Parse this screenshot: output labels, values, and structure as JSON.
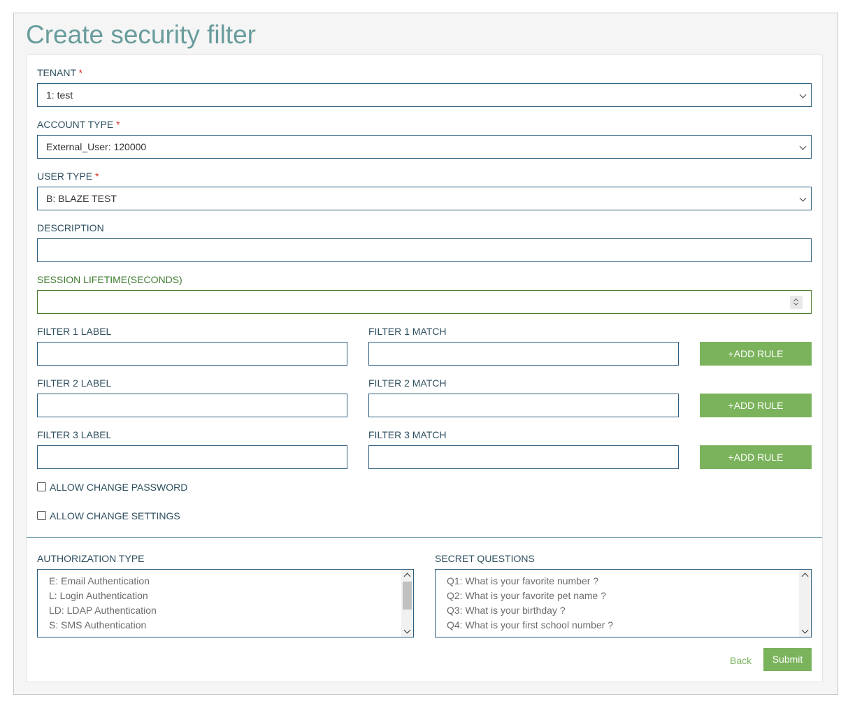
{
  "page": {
    "title": "Create security filter"
  },
  "tenant": {
    "label": "TENANT",
    "required_mark": "*",
    "value": "1: test"
  },
  "account_type": {
    "label": "ACCOUNT TYPE",
    "required_mark": "*",
    "value": "External_User: 120000"
  },
  "user_type": {
    "label": "USER TYPE",
    "required_mark": "*",
    "value": "B: BLAZE TEST"
  },
  "description": {
    "label": "DESCRIPTION",
    "value": ""
  },
  "session_lifetime": {
    "label": "SESSION LIFETIME(SECONDS)",
    "value": ""
  },
  "filters": [
    {
      "label_title": "FILTER 1 LABEL",
      "match_title": "FILTER 1 MATCH",
      "label_value": "",
      "match_value": "",
      "add_rule": "+ADD RULE"
    },
    {
      "label_title": "FILTER 2 LABEL",
      "match_title": "FILTER 2 MATCH",
      "label_value": "",
      "match_value": "",
      "add_rule": "+ADD RULE"
    },
    {
      "label_title": "FILTER 3 LABEL",
      "match_title": "FILTER 3 MATCH",
      "label_value": "",
      "match_value": "",
      "add_rule": "+ADD RULE"
    }
  ],
  "checkboxes": {
    "allow_change_password": {
      "label": "ALLOW CHANGE PASSWORD",
      "checked": false
    },
    "allow_change_settings": {
      "label": "ALLOW CHANGE SETTINGS",
      "checked": false
    }
  },
  "authorization_type": {
    "label": "AUTHORIZATION TYPE",
    "options": [
      "E: Email Authentication",
      "L: Login Authentication",
      "LD: LDAP Authentication",
      "S: SMS Authentication"
    ]
  },
  "secret_questions": {
    "label": "SECRET QUESTIONS",
    "options": [
      "Q1: What is your favorite number ?",
      "Q2: What is your favorite pet name ?",
      "Q3: What is your birthday ?",
      "Q4: What is your first school number ?"
    ]
  },
  "actions": {
    "back": "Back",
    "submit": "Submit"
  },
  "colors": {
    "accent_green": "#7bb35c",
    "title_teal": "#6a9c9c",
    "border_blue": "#2f5f80",
    "required_red": "#d9302c"
  },
  "icons": {
    "select_arrow": "chevron-down-icon",
    "spinner": "number-spinner-icon"
  }
}
